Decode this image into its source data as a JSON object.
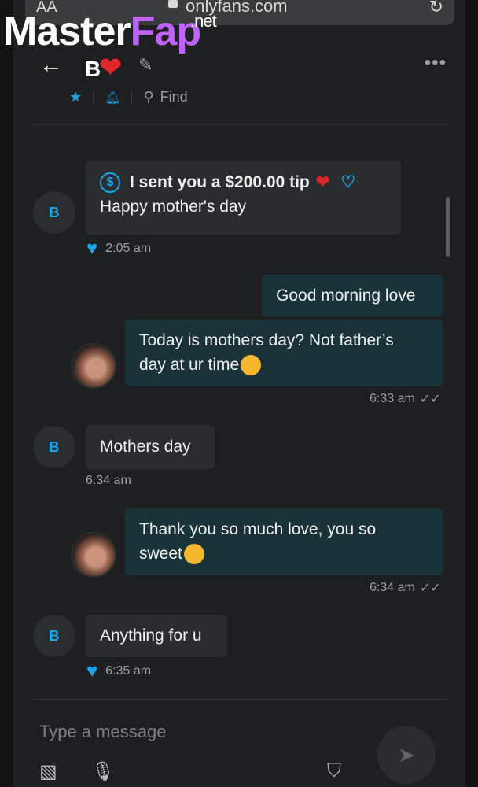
{
  "browser": {
    "aa_label": "AA",
    "url": "onlyfans.com",
    "reload_icon": "reload-icon"
  },
  "watermark": {
    "part1": "Master",
    "part2": "Fap",
    "suffix": ".net"
  },
  "header": {
    "contact_initial": "B",
    "heart": "❤",
    "find_label": "Find",
    "more": "•••"
  },
  "messages": [
    {
      "sender": "B",
      "tip_text": "I sent you a $200.00 tip",
      "text": "Happy mother's day",
      "time": "2:05 am",
      "liked": true
    },
    {
      "sender": "me",
      "text": "Good morning love"
    },
    {
      "sender": "me",
      "text1": "Today is mothers day? Not father’s",
      "text2": "day at ur time",
      "time": "6:33 am"
    },
    {
      "sender": "B",
      "text": "Mothers day",
      "time": "6:34 am"
    },
    {
      "sender": "me",
      "text1": "Thank you so much love, you so",
      "text2": "sweet",
      "time": "6:34 am"
    },
    {
      "sender": "B",
      "text": "Anything for u",
      "time": "6:35 am",
      "liked": true
    }
  ],
  "composer": {
    "placeholder": "Type a message"
  },
  "colors": {
    "accent": "#1ba4e6",
    "heart": "#e0262b",
    "my_bubble": "#193338",
    "their_bubble": "#2a2d30"
  }
}
